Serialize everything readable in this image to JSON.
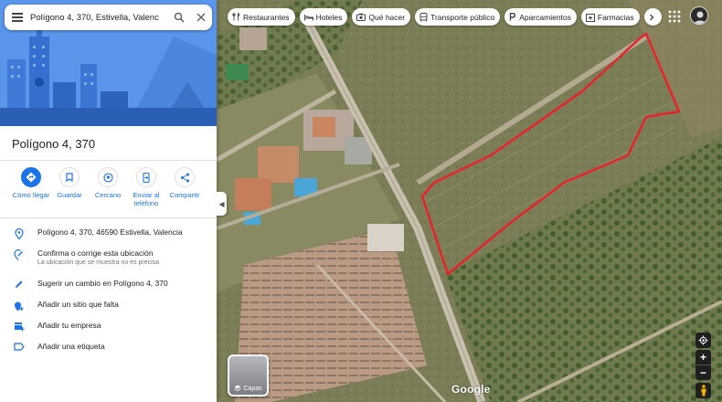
{
  "search": {
    "value": "Polígono 4, 370, Estivella, Valenc"
  },
  "place": {
    "title": "Polígono 4, 370"
  },
  "actions": [
    {
      "label": "Cómo llegar",
      "icon": "directions-icon"
    },
    {
      "label": "Guardar",
      "icon": "bookmark-icon"
    },
    {
      "label": "Cercano",
      "icon": "nearby-icon"
    },
    {
      "label": "Enviar al teléfono",
      "icon": "send-to-phone-icon"
    },
    {
      "label": "Compartir",
      "icon": "share-icon"
    }
  ],
  "info": {
    "address": "Polígono 4, 370, 46590 Estivella, Valencia",
    "confirm": "Confirma o corrige esta ubicación",
    "confirm_sub": "La ubicación que se muestra no es precisa",
    "suggest": "Sugerir un cambio en Polígono 4, 370",
    "add_place": "Añadir un sitio que falta",
    "add_business": "Añadir tu empresa",
    "add_label": "Añadir una etiqueta"
  },
  "chips": [
    {
      "label": "Restaurantes",
      "icon": "fork-knife-icon"
    },
    {
      "label": "Hoteles",
      "icon": "bed-icon"
    },
    {
      "label": "Qué hacer",
      "icon": "camera-icon"
    },
    {
      "label": "Transporte público",
      "icon": "transit-icon"
    },
    {
      "label": "Aparcamientos",
      "icon": "parking-icon"
    },
    {
      "label": "Farmacias",
      "icon": "pharmacy-icon"
    }
  ],
  "layers": {
    "label": "Capas"
  },
  "map": {
    "logo": "Google"
  },
  "colors": {
    "accent": "#1a73e8",
    "boundary": "#e8232a"
  }
}
